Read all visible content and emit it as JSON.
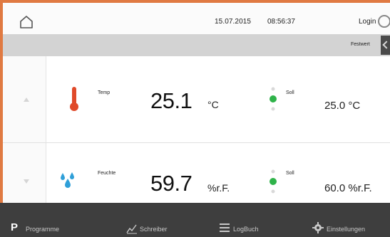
{
  "header": {
    "date": "15.07.2015",
    "time": "08:56:37",
    "login_label": "Login"
  },
  "subbar": {
    "mode_label": "Festwert"
  },
  "rows": [
    {
      "label": "Temp",
      "value": "25.1",
      "unit": "°C",
      "setpoint_label": "Soll",
      "setpoint_value": "25.0 °C",
      "icon": "thermometer-icon"
    },
    {
      "label": "Feuchte",
      "value": "59.7",
      "unit": "%r.F.",
      "setpoint_label": "Soll",
      "setpoint_value": "60.0 %r.F.",
      "icon": "water-drops-icon"
    }
  ],
  "footer": {
    "items": [
      {
        "label": "Programme",
        "icon": "p-icon"
      },
      {
        "label": "Schreiber",
        "icon": "chart-icon"
      },
      {
        "label": "LogBuch",
        "icon": "list-icon"
      },
      {
        "label": "Einstellungen",
        "icon": "gear-icon"
      }
    ]
  },
  "colors": {
    "accent": "#e07a42",
    "indicator_green": "#2fb34a",
    "water_blue": "#2f9fd8",
    "footer_bg": "#3e3e3e"
  }
}
